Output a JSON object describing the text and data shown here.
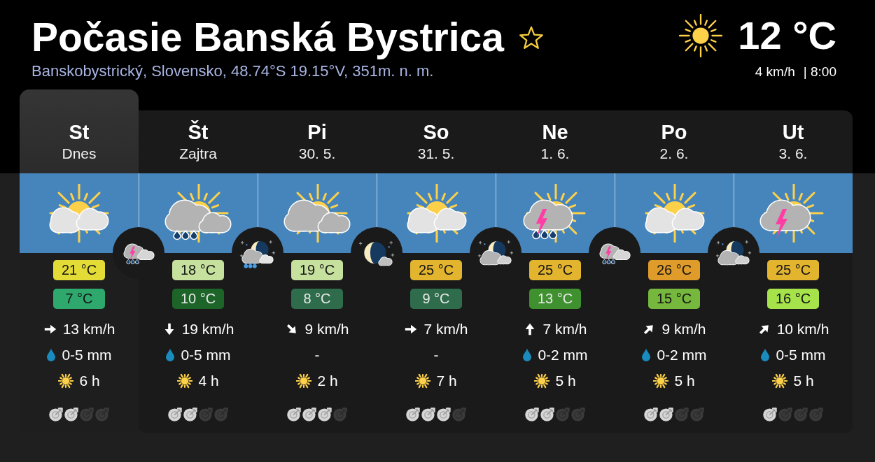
{
  "header": {
    "title": "Počasie Banská Bystrica",
    "favorite": false,
    "subtitle": "Banskobystrický, Slovensko, 48.74°S 19.15°V, 351m. n. m."
  },
  "current": {
    "icon": {
      "kind": "sun"
    },
    "temperature": "12 °C",
    "wind": "4 km/h",
    "time": "| 8:00"
  },
  "days": [
    {
      "name": "St",
      "date": "Dnes",
      "selected": true,
      "day_icon": {
        "kind": "suncloud"
      },
      "night_icon": {
        "kind": "thunderrain"
      },
      "high": {
        "text": "21 °C",
        "color": "#e4dc36"
      },
      "low": {
        "text": "7 °C",
        "color": "#2ea86c"
      },
      "wind_arrow": {
        "kind": "east"
      },
      "wind": "13 km/h",
      "rain": true,
      "precipitation": "0-5 mm",
      "sunshine": "6 h",
      "stars": 2
    },
    {
      "name": "Št",
      "date": "Zajtra",
      "selected": false,
      "day_icon": {
        "kind": "rain"
      },
      "night_icon": {
        "kind": "moonrain"
      },
      "high": {
        "text": "18 °C",
        "color": "#c6e09e"
      },
      "low": {
        "text": "10 °C",
        "color": "#1c6428"
      },
      "wind_arrow": {
        "kind": "south"
      },
      "wind": "19 km/h",
      "rain": true,
      "precipitation": "0-5 mm",
      "sunshine": "4 h",
      "stars": 2
    },
    {
      "name": "Pi",
      "date": "30. 5.",
      "selected": false,
      "day_icon": {
        "kind": "cloudy"
      },
      "night_icon": {
        "kind": "crescent"
      },
      "high": {
        "text": "19 °C",
        "color": "#c6e09e"
      },
      "low": {
        "text": "8 °C",
        "color": "#2e6c4c"
      },
      "wind_arrow": {
        "kind": "southeast"
      },
      "wind": "9 km/h",
      "rain": false,
      "precipitation": "-",
      "sunshine": "2 h",
      "stars": 3
    },
    {
      "name": "So",
      "date": "31. 5.",
      "selected": false,
      "day_icon": {
        "kind": "suncloud"
      },
      "night_icon": {
        "kind": "mooncloud"
      },
      "high": {
        "text": "25 °C",
        "color": "#e3b52f"
      },
      "low": {
        "text": "9 °C",
        "color": "#2e6c4c"
      },
      "wind_arrow": {
        "kind": "east"
      },
      "wind": "7 km/h",
      "rain": false,
      "precipitation": "-",
      "sunshine": "7 h",
      "stars": 3
    },
    {
      "name": "Ne",
      "date": "1. 6.",
      "selected": false,
      "day_icon": {
        "kind": "thunderrain"
      },
      "night_icon": {
        "kind": "thunderrain"
      },
      "high": {
        "text": "25 °C",
        "color": "#e3b52f"
      },
      "low": {
        "text": "13 °C",
        "color": "#3f9130"
      },
      "wind_arrow": {
        "kind": "north"
      },
      "wind": "7 km/h",
      "rain": true,
      "precipitation": "0-2 mm",
      "sunshine": "5 h",
      "stars": 2
    },
    {
      "name": "Po",
      "date": "2. 6.",
      "selected": false,
      "day_icon": {
        "kind": "suncloud"
      },
      "night_icon": {
        "kind": "mooncloud"
      },
      "high": {
        "text": "26 °C",
        "color": "#e09c2a"
      },
      "low": {
        "text": "15 °C",
        "color": "#76b83e"
      },
      "wind_arrow": {
        "kind": "northeast"
      },
      "wind": "9 km/h",
      "rain": true,
      "precipitation": "0-2 mm",
      "sunshine": "5 h",
      "stars": 2
    },
    {
      "name": "Ut",
      "date": "3. 6.",
      "selected": false,
      "day_icon": {
        "kind": "thunder"
      },
      "high": {
        "text": "25 °C",
        "color": "#e3b52f"
      },
      "low": {
        "text": "16 °C",
        "color": "#a6e34a"
      },
      "wind_arrow": {
        "kind": "northeast"
      },
      "wind": "10 km/h",
      "rain": true,
      "precipitation": "0-5 mm",
      "sunshine": "5 h",
      "stars": 1
    }
  ]
}
